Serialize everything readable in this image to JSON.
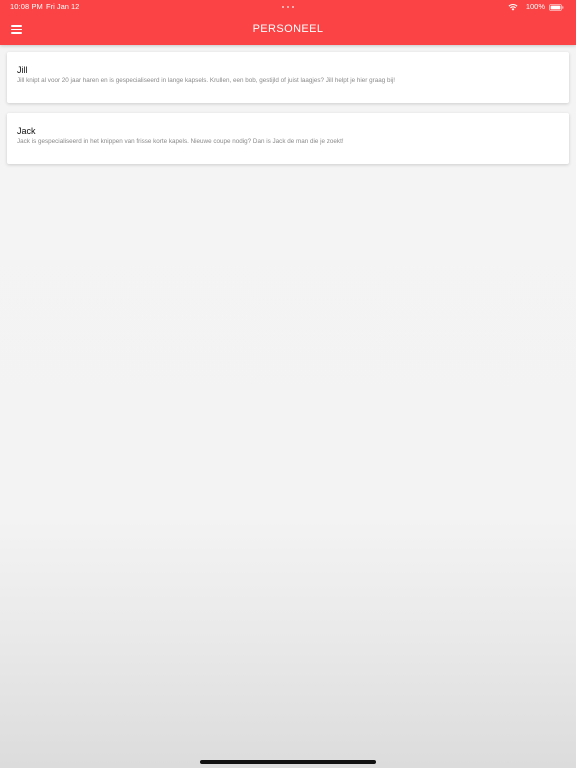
{
  "status_bar": {
    "time": "10:08 PM",
    "date": "Fri Jan 12",
    "battery": "100%"
  },
  "header": {
    "title": "PERSONEEL",
    "menu_icon": "hamburger-menu-icon",
    "background_color": "#fb4345"
  },
  "staff": [
    {
      "name": "Jill",
      "description": "Jill knipt al voor 20 jaar haren en is gespecialiseerd in lange kapsels. Krullen, een bob, gestijld of juist laagjes? Jill helpt je hier graag bij!"
    },
    {
      "name": "Jack",
      "description": "Jack is gespecialiseerd in het knippen van frisse korte kapels. Nieuwe coupe nodig? Dan is Jack de man die je zoekt!"
    }
  ]
}
